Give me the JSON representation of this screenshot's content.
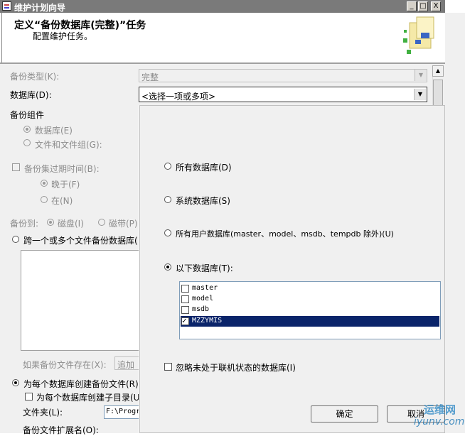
{
  "window": {
    "title": "维护计划向导",
    "minimize": "_",
    "maximize": "□",
    "close": "X"
  },
  "header": {
    "title": "定义“备份数据库(完整)”任务",
    "subtitle": "配置维护任务。"
  },
  "form": {
    "backup_type_label": "备份类型(K):",
    "backup_type_value": "完整",
    "database_label": "数据库(D):",
    "database_value": "<选择一项或多项>",
    "backup_component_label": "备份组件",
    "component_database": "数据库(E)",
    "component_files": "文件和文件组(G):",
    "expire_label": "备份集过期时间(B):",
    "expire_after": "晚于(F)",
    "expire_on": "在(N)",
    "backup_to_label": "备份到:",
    "backup_to_disk": "磁盘(I)",
    "backup_to_tape": "磁带(P)",
    "span_files_label": "跨一个或多个文件备份数据库(",
    "if_exists_label": "如果备份文件存在(X):",
    "if_exists_value": "追加",
    "per_db_file_label": "为每个数据库创建备份文件(R)",
    "per_db_subdir_label": "为每个数据库创建子目录(U",
    "folder_label": "文件夹(L):",
    "folder_value": "F:\\Progr",
    "extension_label": "备份文件扩展名(O):"
  },
  "popup": {
    "all_databases": "所有数据库(D)",
    "system_databases": "系统数据库(S)",
    "all_user_databases": "所有用户数据库(master、model、msdb、tempdb 除外)(U)",
    "these_databases": "以下数据库(T):",
    "databases": [
      {
        "name": "master",
        "checked": false,
        "selected": false
      },
      {
        "name": "model",
        "checked": false,
        "selected": false
      },
      {
        "name": "msdb",
        "checked": false,
        "selected": false
      },
      {
        "name": "MZZYMIS",
        "checked": true,
        "selected": true
      }
    ],
    "ignore_offline": "忽略未处于联机状态的数据库(I)",
    "ok_button": "确定",
    "cancel_button": "取消"
  },
  "watermark": {
    "line1": "运维网",
    "line2": "iyunv.com"
  },
  "colors": {
    "selection": "#0a246a",
    "titlebar": "#7a7a7a",
    "panel": "#f0f0f0"
  }
}
